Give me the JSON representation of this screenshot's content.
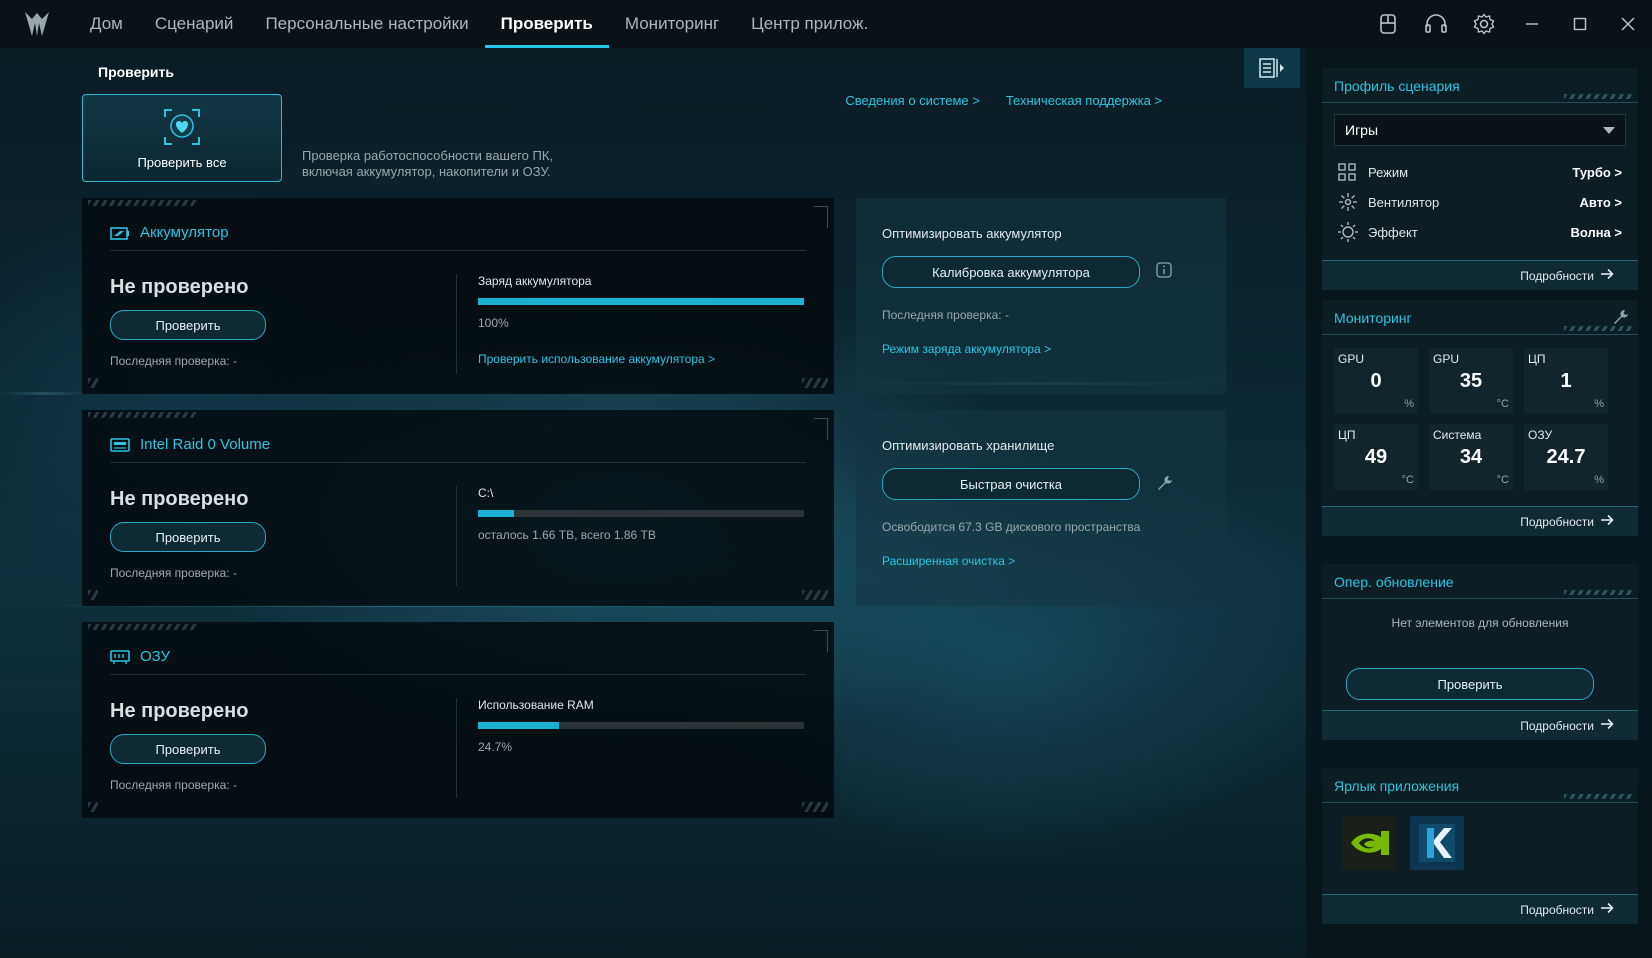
{
  "nav": {
    "items": [
      "Дом",
      "Сценарий",
      "Персональные настройки",
      "Проверить",
      "Мониторинг",
      "Центр прилож."
    ],
    "active_index": 3
  },
  "window_icons": [
    "keyboard-icon",
    "headset-icon",
    "settings-icon",
    "minimize-icon",
    "maximize-icon",
    "close-icon"
  ],
  "main": {
    "page_title": "Проверить",
    "check_all_label": "Проверить все",
    "check_all_desc_line1": "Проверка работоспособности вашего ПК,",
    "check_all_desc_line2": "включая аккумулятор, накопители и ОЗУ.",
    "link_system_info": "Сведения о системе >",
    "link_support": "Техническая поддержка >"
  },
  "cards": [
    {
      "title": "Аккумулятор",
      "status": "Не проверено",
      "button": "Проверить",
      "last_check": "Последняя проверка: -",
      "metric_title": "Заряд аккумулятора",
      "metric_value": "100%",
      "metric_fraction": 1.0,
      "metric_link": "Проверить использование аккумулятора >"
    },
    {
      "title": "Intel Raid 0 Volume",
      "status": "Не проверено",
      "button": "Проверить",
      "last_check": "Последняя проверка: -",
      "metric_title": "C:\\",
      "metric_value": "осталось 1.66 TB, всего 1.86 TB",
      "metric_fraction": 0.11,
      "metric_link": ""
    },
    {
      "title": "ОЗУ",
      "status": "Не проверено",
      "button": "Проверить",
      "last_check": "Последняя проверка: -",
      "metric_title": "Использование RAM",
      "metric_value": "24.7%",
      "metric_fraction": 0.247,
      "metric_link": ""
    }
  ],
  "optimize": [
    {
      "title": "Оптимизировать аккумулятор",
      "button": "Калибровка аккумулятора",
      "text": "Последняя проверка: -",
      "link": "Режим заряда аккумулятора >"
    },
    {
      "title": "Оптимизировать хранилище",
      "button": "Быстрая очистка",
      "text": "Освободится 67.3 GB дискового пространства",
      "link": "Расширенная очистка >"
    }
  ],
  "sidebar": {
    "profile": {
      "title": "Профиль сценария",
      "selected": "Игры",
      "rows": [
        {
          "label": "Режим",
          "value": "Турбо >"
        },
        {
          "label": "Вентилятор",
          "value": "Авто >"
        },
        {
          "label": "Эффект",
          "value": "Волна >"
        }
      ],
      "details": "Подробности"
    },
    "monitoring": {
      "title": "Мониторинг",
      "tiles": [
        {
          "label": "GPU",
          "value": "0",
          "unit": "%"
        },
        {
          "label": "GPU",
          "value": "35",
          "unit": "°C"
        },
        {
          "label": "ЦП",
          "value": "1",
          "unit": "%"
        },
        {
          "label": "ЦП",
          "value": "49",
          "unit": "°C"
        },
        {
          "label": "Система",
          "value": "34",
          "unit": "°C"
        },
        {
          "label": "ОЗУ",
          "value": "24.7",
          "unit": "%"
        }
      ],
      "details": "Подробности"
    },
    "update": {
      "title": "Опер. обновление",
      "text": "Нет элементов для обновления",
      "button": "Проверить",
      "details": "Подробности"
    },
    "shortcuts": {
      "title": "Ярлык приложения",
      "apps": [
        "nvidia-icon",
        "killer-icon"
      ],
      "details": "Подробности"
    }
  },
  "colors": {
    "accent": "#22c7e6",
    "bar_fill": "#1cb0d2",
    "nvidia_green": "#76b900",
    "killer_blue": "#1a8fd0"
  }
}
